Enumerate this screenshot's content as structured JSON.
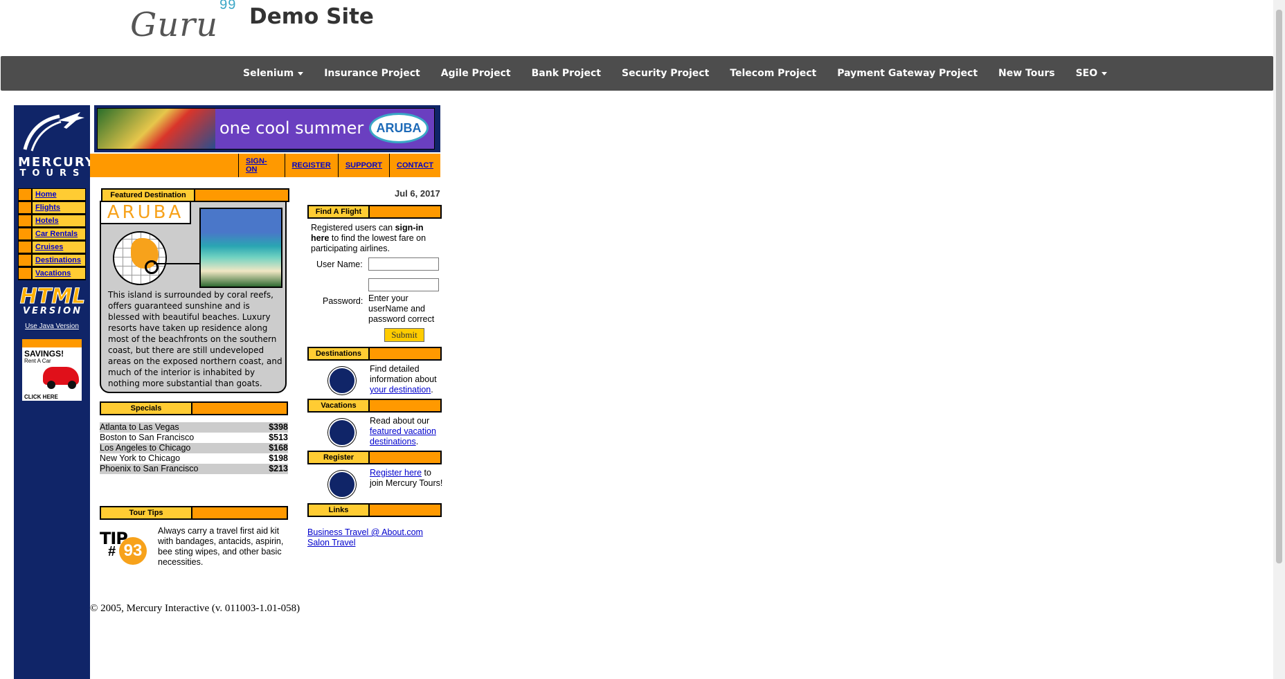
{
  "header": {
    "logo_text": "Guru",
    "logo_sup": "99",
    "site_title": "Demo Site",
    "nav": [
      {
        "label": "Selenium",
        "dropdown": true
      },
      {
        "label": "Insurance Project",
        "dropdown": false
      },
      {
        "label": "Agile Project",
        "dropdown": false
      },
      {
        "label": "Bank Project",
        "dropdown": false
      },
      {
        "label": "Security Project",
        "dropdown": false
      },
      {
        "label": "Telecom Project",
        "dropdown": false
      },
      {
        "label": "Payment Gateway Project",
        "dropdown": false
      },
      {
        "label": "New Tours",
        "dropdown": false
      },
      {
        "label": "SEO",
        "dropdown": true
      }
    ]
  },
  "leftnav": {
    "logo_line1": "MERCURY",
    "logo_line2": "TOURS",
    "menu": [
      "Home",
      "Flights",
      "Hotels",
      "Car Rentals",
      "Cruises",
      "Destinations",
      "Vacations"
    ],
    "html_logo": "HTML",
    "html_logo_sub": "VERSION",
    "java_link": "Use Java Version",
    "ad": {
      "title": "SAVINGS!",
      "sub": "Rent A Car",
      "cta": "CLICK HERE"
    }
  },
  "banner": {
    "text": "one cool summer",
    "badge": "ARUBA"
  },
  "toplinks": [
    "SIGN-ON",
    "REGISTER",
    "SUPPORT",
    "CONTACT"
  ],
  "date": "Jul 6, 2017",
  "featured": {
    "header": "Featured Destination",
    "title": "ARUBA",
    "text": "This island is surrounded by coral reefs, offers guaranteed sunshine and is blessed with beautiful beaches. Luxury resorts have taken up residence along most of the beachfronts on the southern coast, but there are still undeveloped areas on the exposed northern coast, and much of the interior is inhabited by nothing more substantial than goats."
  },
  "specials": {
    "header": "Specials",
    "rows": [
      {
        "route": "Atlanta to Las Vegas",
        "price": "$398"
      },
      {
        "route": "Boston to San Francisco",
        "price": "$513"
      },
      {
        "route": "Los Angeles to Chicago",
        "price": "$168"
      },
      {
        "route": "New York to Chicago",
        "price": "$198"
      },
      {
        "route": "Phoenix to San Francisco",
        "price": "$213"
      }
    ]
  },
  "tourtips": {
    "header": "Tour Tips",
    "tip_label": "TIP",
    "tip_hash": "#",
    "tip_number": "93",
    "text": "Always carry a travel first aid kit with bandages, antacids, aspirin, bee sting wipes, and other basic necessities."
  },
  "findflight": {
    "header": "Find A Flight",
    "intro_pre": "Registered users can ",
    "intro_bold": "sign-in here",
    "intro_post": " to find the lowest fare on participating airlines.",
    "user_label": "User Name:",
    "user_value": "",
    "pass_label": "Password:",
    "pass_value": "",
    "pass_note": "Enter your userName and password correct",
    "submit": "Submit"
  },
  "destinations": {
    "header": "Destinations",
    "pre": "Find detailed information about ",
    "link": "your destination",
    "post": "."
  },
  "vacations": {
    "header": "Vacations",
    "pre": "Read about our ",
    "link": "featured vacation destinations",
    "post": "."
  },
  "register": {
    "header": "Register",
    "link": "Register here",
    "post": " to join Mercury Tours!"
  },
  "links": {
    "header": "Links",
    "items": [
      "Business Travel @ About.com",
      "Salon Travel"
    ]
  },
  "footer": "© 2005, Mercury Interactive (v. 011003-1.01-058)"
}
